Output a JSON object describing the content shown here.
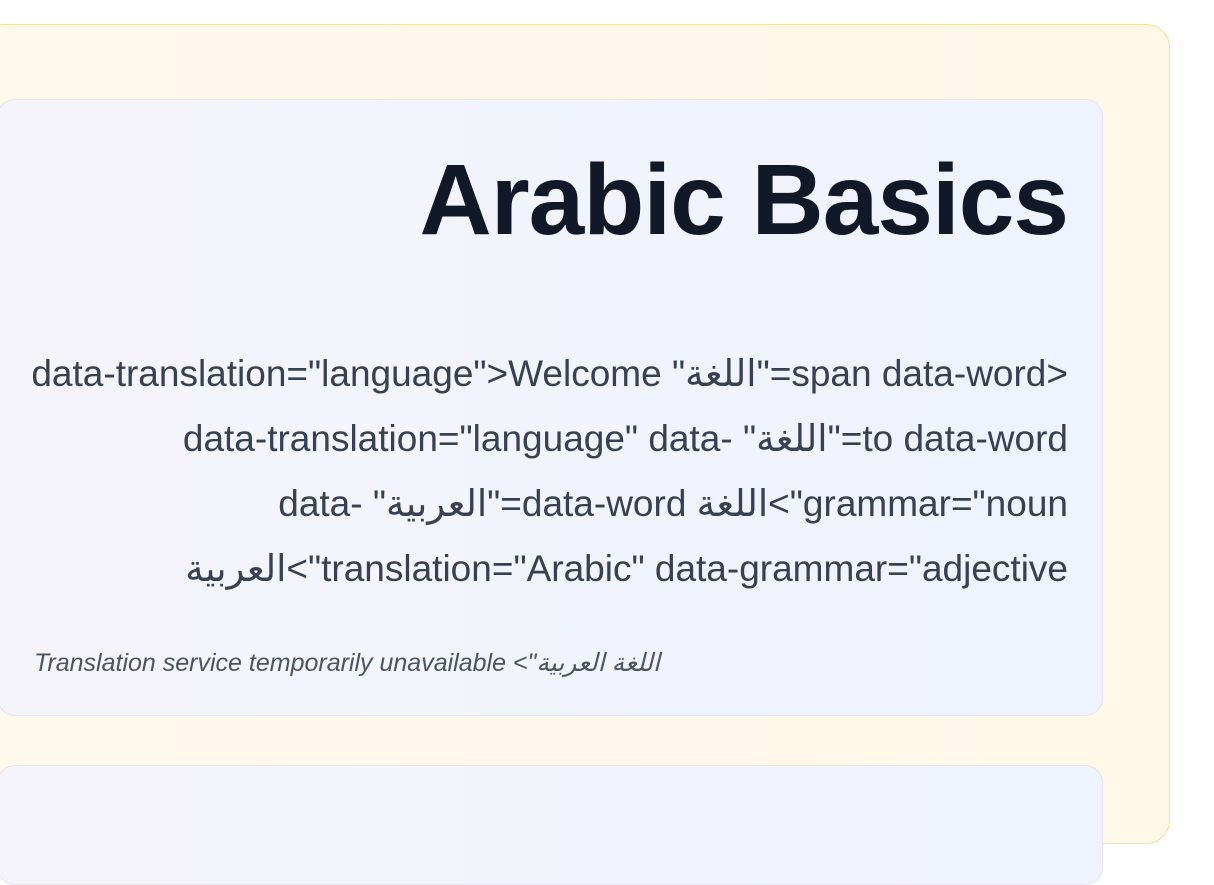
{
  "lesson_card": {
    "title": "Arabic Basics",
    "body_text": "<span data-word=\"اللغة\" data-translation=\"language\">Welcome to data-word=\"اللغة\" data-translation=\"language\" data-grammar=\"noun\">اللغة data-word=\"العربية\" data-translation=\"Arabic\" data-grammar=\"adjective\">العربية",
    "status_note": "اللغة العربية\"> Translation service temporarily unavailable"
  },
  "colors": {
    "title": "#111827",
    "body_text": "#374151",
    "note_text": "#4b5563",
    "outer_border": "#f4e39a",
    "card_border": "#e7e4f5"
  }
}
